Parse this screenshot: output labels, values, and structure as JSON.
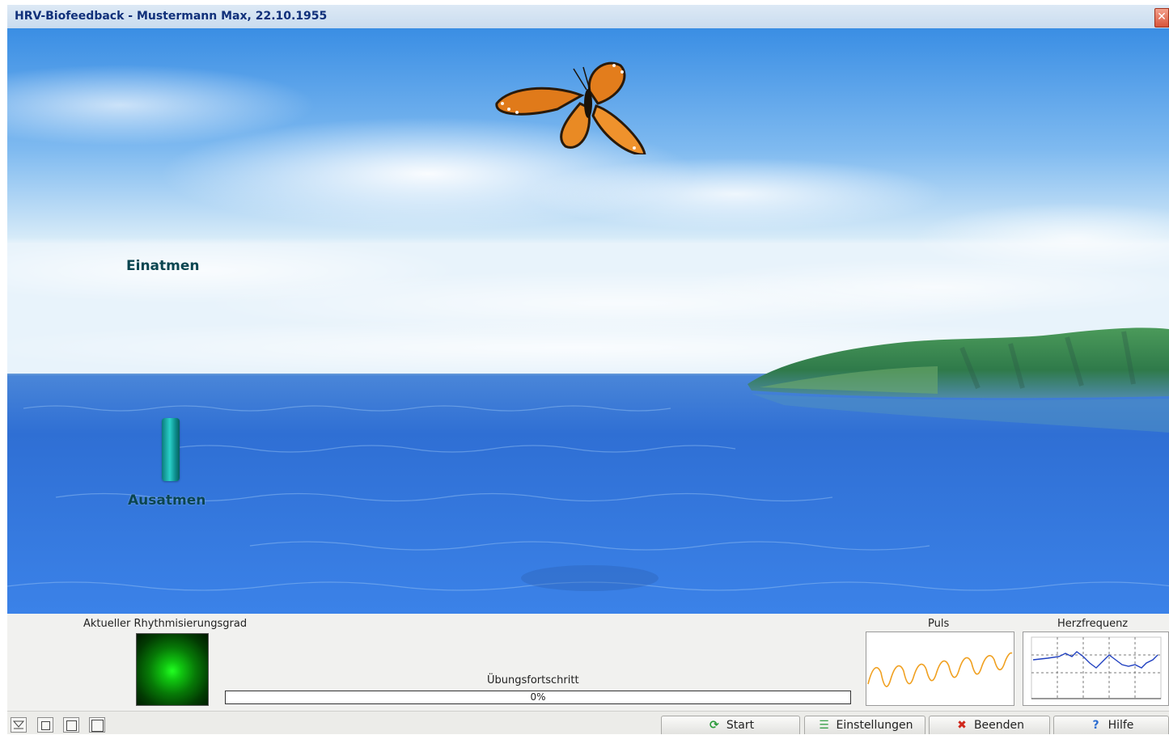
{
  "window": {
    "title": "HRV-Biofeedback - Mustermann Max, 22.10.1955",
    "close_icon": "close-icon"
  },
  "scene": {
    "inhale_label": "Einatmen",
    "exhale_label": "Ausatmen",
    "breath_level": 0.35,
    "sky_color": "#3a8be0",
    "water_color": "#2d6fd8",
    "object_icon": "butterfly-icon"
  },
  "panel": {
    "rhythm_label": "Aktueller Rhythmisierungsgrad",
    "rhythm_color": "#10d010",
    "progress_label": "Übungsfortschritt",
    "progress_text": "0%",
    "progress_value": 0,
    "pulse_label": "Puls",
    "heart_rate_label": "Herzfrequenz",
    "pulse_color": "#f0a020",
    "heart_rate_color": "#2040c0"
  },
  "statusbar": {
    "buttons": [
      {
        "label": "Start",
        "icon": "refresh-icon",
        "color": "#2a9a3a"
      },
      {
        "label": "Einstellungen",
        "icon": "list-icon",
        "color": "#3aa04a"
      },
      {
        "label": "Beenden",
        "icon": "close-icon",
        "color": "#d0281c"
      },
      {
        "label": "Hilfe",
        "icon": "help-icon",
        "color": "#2a6cd0"
      }
    ]
  }
}
